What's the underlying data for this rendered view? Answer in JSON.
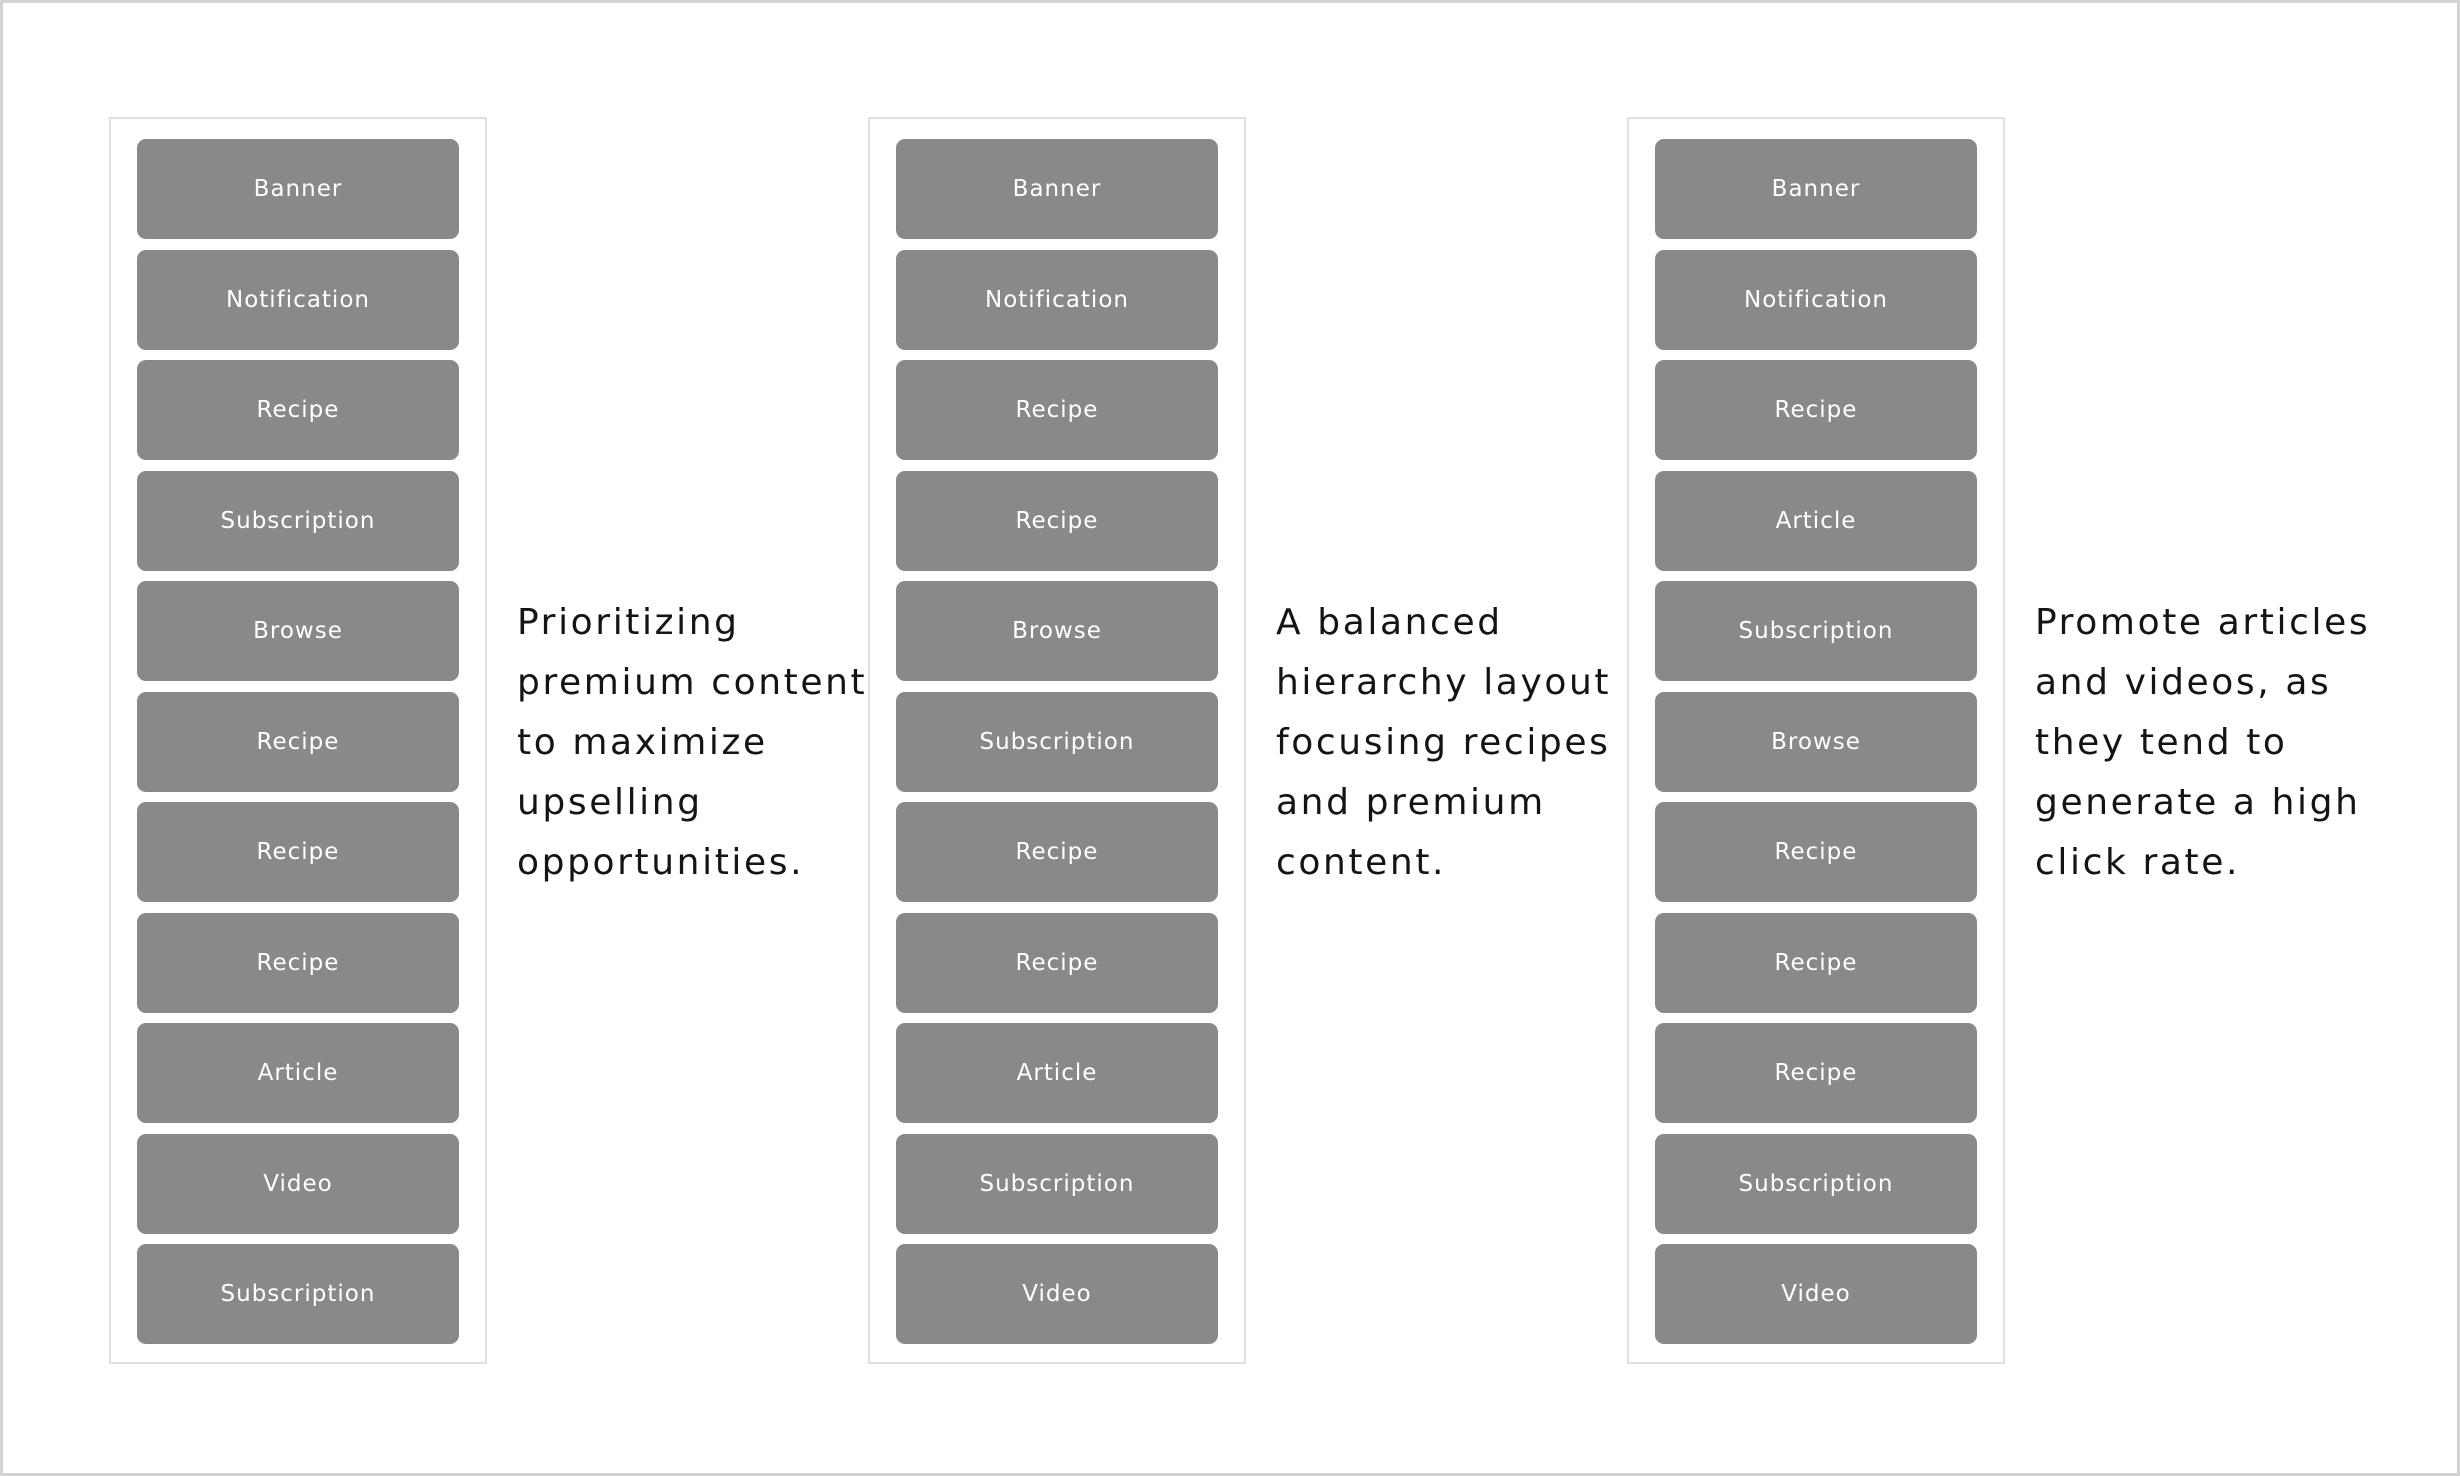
{
  "layouts": [
    {
      "blocks": [
        "Banner",
        "Notification",
        "Recipe",
        "Subscription",
        "Browse",
        "Recipe",
        "Recipe",
        "Recipe",
        "Article",
        "Video",
        "Subscription"
      ],
      "description_lines": [
        "Prioritizing",
        "premium content",
        "to maximize",
        "upselling",
        "opportunities."
      ]
    },
    {
      "blocks": [
        "Banner",
        "Notification",
        "Recipe",
        "Recipe",
        "Browse",
        "Subscription",
        "Recipe",
        "Recipe",
        "Article",
        "Subscription",
        "Video"
      ],
      "description_lines": [
        "A balanced",
        "hierarchy layout",
        "focusing recipes",
        "and premium",
        "content."
      ]
    },
    {
      "blocks": [
        "Banner",
        "Notification",
        "Recipe",
        "Article",
        "Subscription",
        "Browse",
        "Recipe",
        "Recipe",
        "Recipe",
        "Subscription",
        "Video"
      ],
      "description_lines": [
        "Promote articles",
        "and videos, as",
        "they tend to",
        "generate a high",
        "click rate."
      ]
    }
  ],
  "colors": {
    "block": "#898989",
    "block_text": "#ffffff",
    "description_text": "#141414",
    "panel_border": "#e0e0e0"
  }
}
